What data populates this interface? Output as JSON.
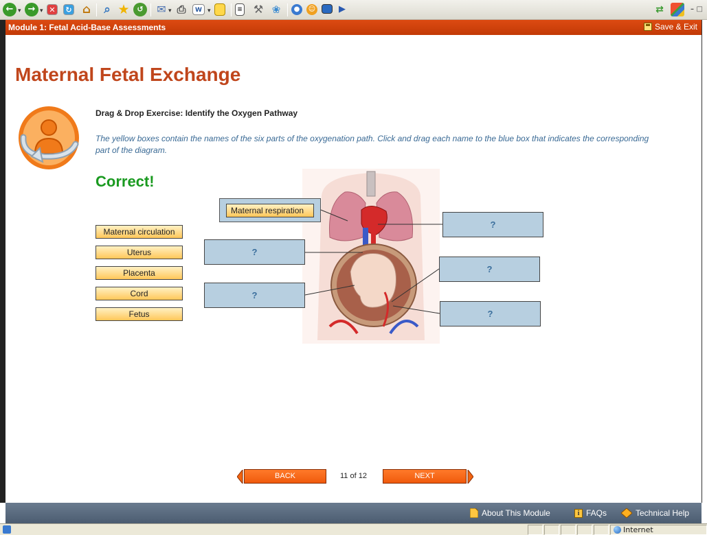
{
  "browser": {
    "toolbar_icons": [
      "back-icon",
      "forward-icon",
      "stop-icon",
      "refresh-icon",
      "home-icon",
      "search-icon",
      "favorites-icon",
      "history-icon",
      "mail-icon",
      "print-icon",
      "edit-icon",
      "discuss-icon",
      "research-icon",
      "messenger-icon",
      "tools-icon",
      "media-icon",
      "bookmark-icon",
      "screen-icon",
      "arrow-icon"
    ]
  },
  "header": {
    "module_title": "Module 1: Fetal Acid-Base Assessments",
    "save_exit": "Save & Exit"
  },
  "page": {
    "title": "Maternal Fetal Exchange",
    "exercise_title": "Drag & Drop Exercise: Identify the Oxygen Pathway",
    "instructions": "The yellow boxes contain the names of the six parts of the oxygenation path. Click and drag each name to the blue box that indicates the corresponding part of the diagram.",
    "feedback": "Correct!"
  },
  "drag_items": {
    "placed": "Maternal respiration",
    "list": [
      "Maternal circulation",
      "Uterus",
      "Placenta",
      "Cord",
      "Fetus"
    ]
  },
  "drop_targets": [
    "?",
    "?",
    "?",
    "?",
    "?"
  ],
  "nav": {
    "back": "BACK",
    "page_count": "11 of 12",
    "next": "NEXT"
  },
  "footer": {
    "about": "About This Module",
    "faqs": "FAQs",
    "tech_help": "Technical Help"
  },
  "status": {
    "zone": "Internet"
  },
  "colors": {
    "accent": "#c0461c",
    "header_bar": "#cc3f08",
    "correct": "#1a9a20",
    "drop_box": "#b7cfe0",
    "footer": "#566779"
  }
}
